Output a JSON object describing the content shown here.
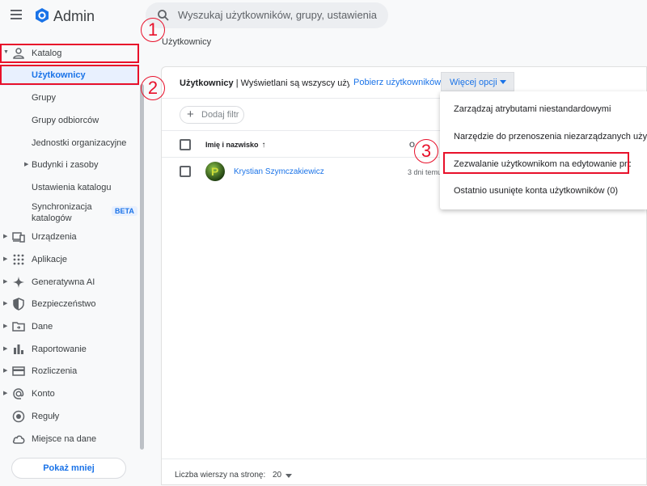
{
  "header": {
    "app_title": "Admin",
    "search_placeholder": "Wyszukaj użytkowników, grupy, ustawienia"
  },
  "sidebar": {
    "items": [
      {
        "label": "Katalog",
        "icon": "person-icon"
      },
      {
        "label": "Użytkownicy"
      },
      {
        "label": "Grupy"
      },
      {
        "label": "Grupy odbiorców"
      },
      {
        "label": "Jednostki organizacyjne"
      },
      {
        "label": "Budynki i zasoby"
      },
      {
        "label": "Ustawienia katalogu"
      },
      {
        "label": "Synchronizacja katalogów",
        "line1": "Synchronizacja",
        "line2": "katalogów",
        "badge": "BETA"
      },
      {
        "label": "Urządzenia",
        "icon": "devices-icon"
      },
      {
        "label": "Aplikacje",
        "icon": "apps-grid-icon"
      },
      {
        "label": "Generatywna AI",
        "icon": "sparkle-icon"
      },
      {
        "label": "Bezpieczeństwo",
        "icon": "shield-icon"
      },
      {
        "label": "Dane",
        "icon": "folder-icon"
      },
      {
        "label": "Raportowanie",
        "icon": "bar-chart-icon"
      },
      {
        "label": "Rozliczenia",
        "icon": "credit-card-icon"
      },
      {
        "label": "Konto",
        "icon": "at-sign-icon"
      },
      {
        "label": "Reguły",
        "icon": "rules-icon"
      },
      {
        "label": "Miejsce na dane",
        "icon": "cloud-icon"
      }
    ],
    "show_less": "Pokaż mniej"
  },
  "main": {
    "breadcrumb": "Użytkownicy",
    "card_title_bold": "Użytkownicy",
    "card_title_rest": " | Wyświetlani są wszyscy użytkownicy",
    "download_link": "Pobierz użytkowników",
    "more_options": "Więcej opcji",
    "add_filter": "Dodaj filtr",
    "col_name": "Imię i nazwisko",
    "col_other": "O",
    "rows": [
      {
        "name": "Krystian Szymczakiewicz",
        "avatar_letter": "P",
        "date": "3 dni temu"
      }
    ],
    "rows_per_page_label": "Liczba wierszy na stronę:",
    "rows_per_page_value": "20"
  },
  "menu": {
    "items": [
      "Zarządzaj atrybutami niestandardowymi",
      "Narzędzie do przenoszenia niezarządzanych użytkowników",
      "Zezwalanie użytkownikom na edytowanie profilu",
      "Ostatnio usunięte konta użytkowników (0)"
    ]
  },
  "annotations": [
    "1",
    "2",
    "3"
  ],
  "colors": {
    "accent": "#1a73e8",
    "highlight_red": "#e8102a"
  }
}
